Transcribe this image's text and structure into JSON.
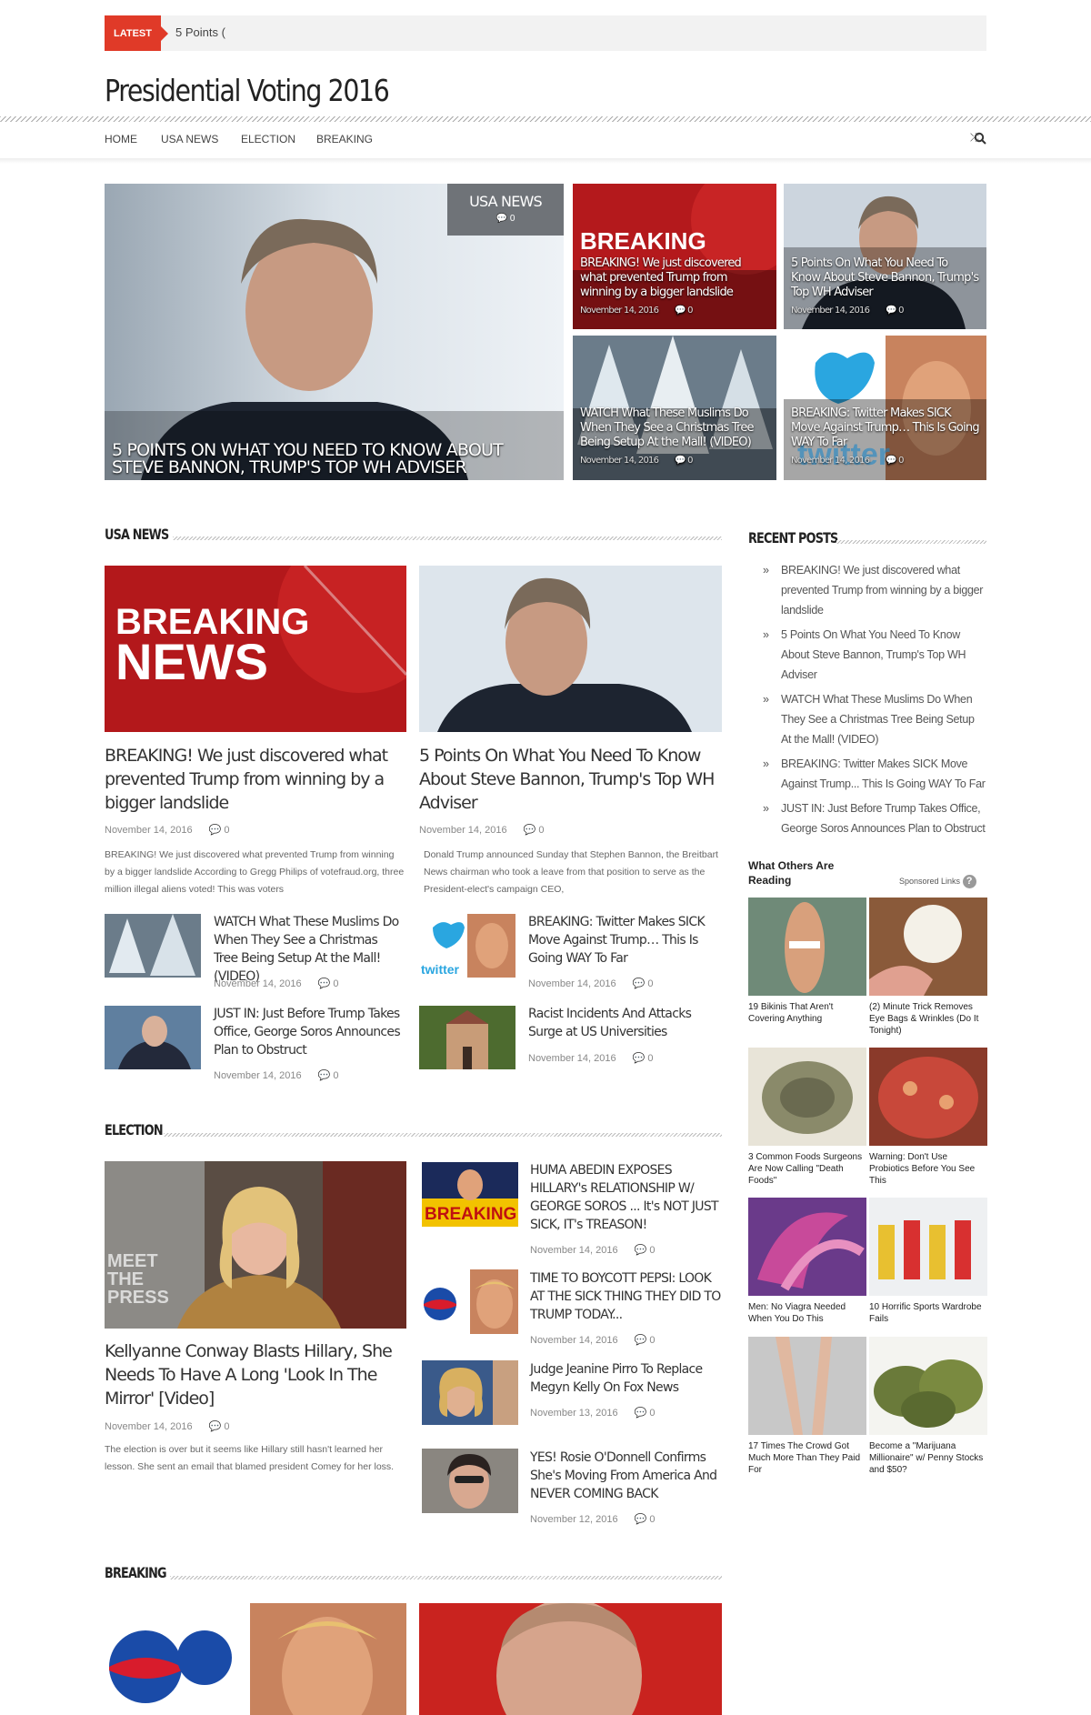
{
  "ticker": {
    "label": "LATEST",
    "text": "5 Points ("
  },
  "site": {
    "title": "Presidential Voting 2016"
  },
  "nav": {
    "items": [
      "HOME",
      "USA NEWS",
      "ELECTION",
      "BREAKING"
    ]
  },
  "featured": {
    "badge": {
      "label": "USA NEWS",
      "comments": "0"
    },
    "main_title": "5 POINTS ON WHAT YOU NEED TO KNOW ABOUT STEVE BANNON, TRUMP'S TOP WH ADVISER",
    "tiles": [
      {
        "title": "BREAKING! We just discovered what prevented Trump from winning by a bigger landslide",
        "date": "November 14, 2016",
        "comments": "0"
      },
      {
        "title": "5 Points On What You Need To Know About Steve Bannon, Trump's Top WH Adviser",
        "date": "November 14, 2016",
        "comments": "0"
      },
      {
        "title": "WATCH What These Muslims Do When They See a Christmas Tree Being Setup At the Mall! (VIDEO)",
        "date": "November 14, 2016",
        "comments": "0"
      },
      {
        "title": "BREAKING: Twitter Makes SICK Move Against Trump… This Is Going WAY To Far",
        "date": "November 14, 2016",
        "comments": "0"
      }
    ],
    "overlay_text": {
      "breaking": "BREAKING",
      "twitter": "twitter"
    }
  },
  "usa_news": {
    "heading": "USA NEWS",
    "image_text": {
      "breaking": "BREAKING",
      "news": "NEWS"
    },
    "main": [
      {
        "title": "BREAKING! We just discovered what prevented Trump from winning by a bigger landslide",
        "date": "November 14, 2016",
        "comments": "0",
        "excerpt": "BREAKING! We just discovered what prevented Trump from winning by a bigger landslide According to Gregg Philips of votefraud.org, three million illegal aliens voted! This was voters"
      },
      {
        "title": "5 Points On What You Need To Know About Steve Bannon, Trump's Top WH Adviser",
        "date": "November 14, 2016",
        "comments": "0",
        "excerpt": "Donald Trump announced Sunday that Stephen Bannon, the Breitbart News chairman who took a leave from that position to serve as the President-elect's campaign CEO,"
      }
    ],
    "small": [
      {
        "title": "WATCH What These Muslims Do When They See a Christmas Tree Being Setup At the Mall! (VIDEO)",
        "date": "November 14, 2016",
        "comments": "0"
      },
      {
        "title": "BREAKING: Twitter Makes SICK Move Against Trump… This Is Going WAY To Far",
        "date": "November 14, 2016",
        "comments": "0"
      },
      {
        "title": "JUST IN: Just Before Trump Takes Office, George Soros Announces Plan to Obstruct",
        "date": "November 14, 2016",
        "comments": "0"
      },
      {
        "title": "Racist Incidents And Attacks Surge at US Universities",
        "date": "November 14, 2016",
        "comments": "0"
      }
    ]
  },
  "election": {
    "heading": "ELECTION",
    "image_text": {
      "meet": "MEET THE PRESS",
      "breaking": "BREAKING"
    },
    "main": {
      "title": "Kellyanne Conway Blasts Hillary, She Needs To Have A Long 'Look In The Mirror' [Video]",
      "date": "November 14, 2016",
      "comments": "0",
      "excerpt": "The election is over but it seems like Hillary still hasn't learned her lesson. She sent an email that blamed president Comey for her loss."
    },
    "small": [
      {
        "title": "HUMA ABEDIN EXPOSES HILLARY's RELATIONSHIP W/ GEORGE SOROS ... It's NOT JUST SICK, IT's TREASON!",
        "date": "November 14, 2016",
        "comments": "0"
      },
      {
        "title": "TIME TO BOYCOTT PEPSI: LOOK AT THE SICK THING THEY DID TO TRUMP TODAY...",
        "date": "November 14, 2016",
        "comments": "0"
      },
      {
        "title": "Judge Jeanine Pirro To Replace Megyn Kelly On Fox News",
        "date": "November 13, 2016",
        "comments": "0"
      },
      {
        "title": "YES! Rosie O'Donnell Confirms She's Moving From America And NEVER COMING BACK",
        "date": "November 12, 2016",
        "comments": "0"
      }
    ]
  },
  "breaking": {
    "heading": "BREAKING"
  },
  "recent": {
    "heading": "RECENT POSTS",
    "items": [
      "BREAKING! We just discovered what prevented Trump from winning by a bigger landslide",
      "5 Points On What You Need To Know About Steve Bannon, Trump's Top WH Adviser",
      "WATCH What These Muslims Do When They See a Christmas Tree Being Setup At the Mall! (VIDEO)",
      "BREAKING: Twitter Makes SICK Move Against Trump... This Is Going WAY To Far",
      "JUST IN: Just Before Trump Takes Office, George Soros Announces Plan to Obstruct"
    ]
  },
  "ads": {
    "heading": "What Others Are Reading",
    "sponsored": "Sponsored Links",
    "items": [
      "19 Bikinis That Aren't Covering Anything",
      "(2) Minute Trick Removes Eye Bags & Wrinkles (Do It Tonight)",
      "3 Common Foods Surgeons Are Now Calling \"Death Foods\"",
      "Warning: Don't Use Probiotics Before You See This",
      "Men: No Viagra Needed When You Do This",
      "10 Horrific Sports Wardrobe Fails",
      "17 Times The Crowd Got Much More Than They Paid For",
      "Become a \"Marijuana Millionaire\" w/ Penny Stocks and $50?"
    ]
  },
  "colors": {
    "accent": "#e03a28",
    "badge": "#6f7378"
  }
}
